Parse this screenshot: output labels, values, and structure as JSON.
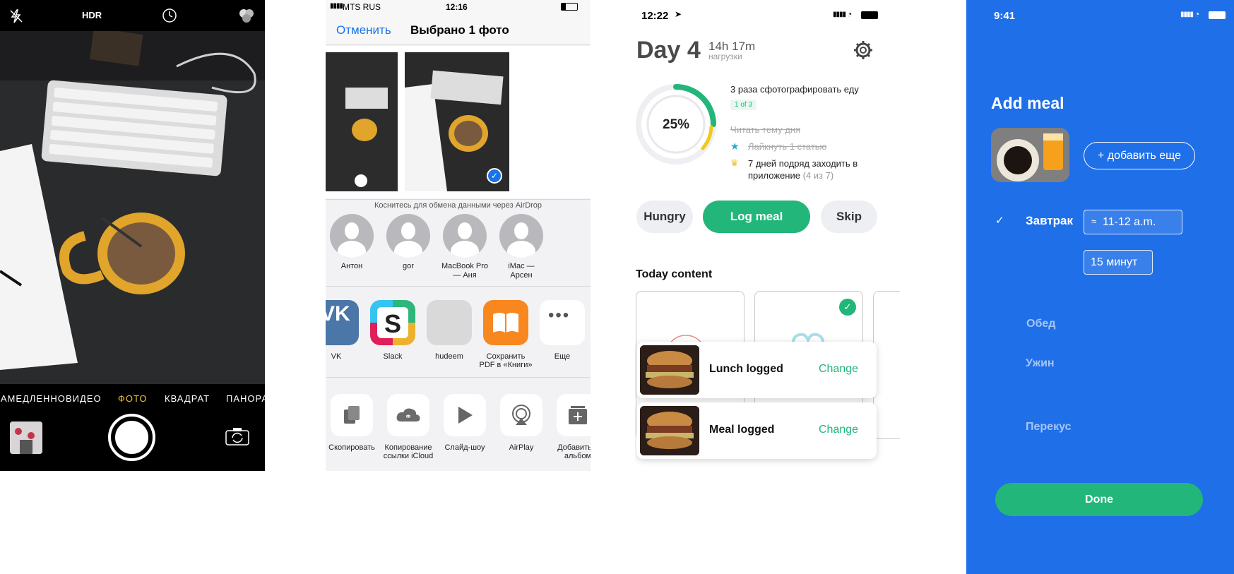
{
  "camera": {
    "top": {
      "hdr": "HDR"
    },
    "modes": [
      "ЗАМЕДЛЕННО",
      "ВИДЕО",
      "ФОТО",
      "КВАДРАТ",
      "ПАНОРАМА"
    ],
    "active_mode": "ФОТО",
    "icons": [
      "flash-off-icon",
      "timer-icon",
      "filters-icon",
      "flip-camera-icon"
    ]
  },
  "share": {
    "status": {
      "carrier": "MTS RUS",
      "time": "12:16"
    },
    "nav": {
      "cancel": "Отменить",
      "title": "Выбрано 1 фото"
    },
    "airdrop_hint": "Коснитесь для обмена данными через AirDrop",
    "people": [
      {
        "name": "Антон"
      },
      {
        "name": "gor"
      },
      {
        "name": "MacBook Pro — Аня"
      },
      {
        "name": "iMac — Арсен"
      }
    ],
    "apps": [
      {
        "label": "VK",
        "color": "#4a76a8"
      },
      {
        "label": "Slack",
        "color": "#ffffff"
      },
      {
        "label": "hudeem",
        "color": "#d9d9d9"
      },
      {
        "label": "Сохранить PDF в «Книги»",
        "color": "#f7871e"
      },
      {
        "label": "Еще",
        "color": "#ffffff"
      }
    ],
    "actions": [
      {
        "label": "Скопировать"
      },
      {
        "label": "Копирование ссылки iCloud"
      },
      {
        "label": "Слайд-шоу"
      },
      {
        "label": "AirPlay"
      },
      {
        "label": "Добавить в альбом"
      }
    ]
  },
  "day": {
    "status": {
      "time": "12:22"
    },
    "title": "Day 4",
    "load_time": "14h 17m",
    "load_label": "нагрузки",
    "progress": {
      "percent_label": "25%",
      "value": 0.25
    },
    "tasks": [
      {
        "text": "3 раза сфотографировать еду",
        "badge": "1 of 3",
        "done": false
      },
      {
        "text": "Читать тему дня",
        "done": true
      },
      {
        "text": "Лайкнуть 1 статью",
        "done": true
      },
      {
        "text": "7 дней подряд заходить в приложение",
        "extra": "(4 из 7)",
        "done": false
      }
    ],
    "buttons": {
      "hungry": "Hungry",
      "log": "Log meal",
      "skip": "Skip"
    },
    "section_title": "Today content",
    "toasts": [
      {
        "title": "Lunch logged",
        "action": "Change"
      },
      {
        "title": "Meal logged",
        "action": "Change"
      }
    ],
    "accent": "#22b67a"
  },
  "meal": {
    "status": {
      "time": "9:41"
    },
    "title": "Add meal",
    "add_more": "+ добавить еще",
    "rows": [
      {
        "label": "Завтрак",
        "time": "11-12 a.m.",
        "time_prefix": "≈",
        "duration": "15 минут",
        "checked": true
      },
      {
        "label": "Обед"
      },
      {
        "label": "Ужин"
      },
      {
        "label": "Перекус"
      }
    ],
    "done": "Done",
    "bg": "#1f6fe8"
  }
}
